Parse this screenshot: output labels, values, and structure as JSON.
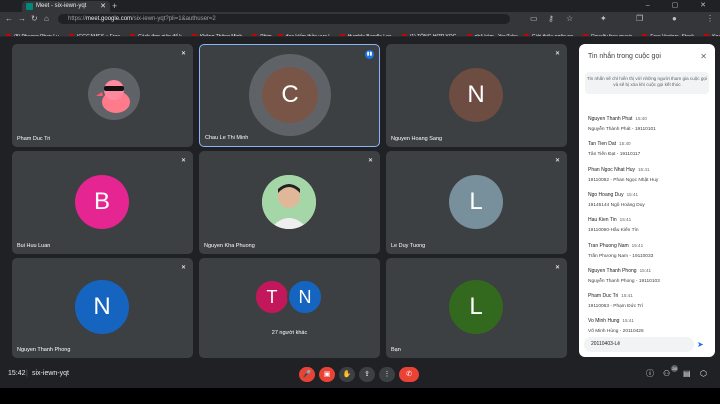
{
  "browser": {
    "tab_title": "Meet - six-iewn-yqt",
    "url_host": "meet.google.com",
    "url_path": "/six-iewn-yqt?pli=1&authuser=2",
    "url_prefix": "https://",
    "bookmarks": [
      "(8) Phuong Phap Lu...",
      "IGGGAMES » Free...",
      "Cách đơn giản để k...",
      "Không Thông Minh...",
      "Phim",
      "đao kiếm thần vực |...",
      "Humble Bundle | ga...",
      "(1) TỔNG HỢP YOG...",
      "phả kèm - YouTube",
      "Giới thiệu ngôn ng...",
      "Royalty free music...",
      "Free Vectors, Stock...",
      "Kpaix | Trang chủ"
    ]
  },
  "participants": [
    {
      "name": "Pham Duc Tri",
      "initial": "",
      "color": "#5f6368"
    },
    {
      "name": "Chau Le Thi Minh",
      "initial": "C",
      "color": "#795548"
    },
    {
      "name": "Nguyen Hoang Sang",
      "initial": "N",
      "color": "#6d4c41"
    },
    {
      "name": "Bui Huu Luan",
      "initial": "B",
      "color": "#e52592"
    },
    {
      "name": "Nguyen Kha Phuong",
      "initial": "",
      "color": "#9e9e9e"
    },
    {
      "name": "Le Duy Tuong",
      "initial": "L",
      "color": "#78909c"
    },
    {
      "name": "Nguyen Thanh Phong",
      "initial": "N",
      "color": "#1565c0"
    },
    {
      "name": "27 người khác",
      "initial": "",
      "color": "#3c4043",
      "others": [
        "T",
        "N"
      ]
    },
    {
      "name": "Bạn",
      "initial": "L",
      "color": "#33691e"
    }
  ],
  "chat": {
    "title": "Tin nhắn trong cuộc gọi",
    "info": "Tin nhắn sẽ chỉ hiển thị với những người tham gia cuộc gọi và sẽ bị xóa khi cuộc gọi kết thúc",
    "messages": [
      {
        "who": "Nguyen Thanh Phat",
        "time": "15:40",
        "text": "Nguyễn Thành Phát - 19110101"
      },
      {
        "who": "Tan Tien Dat",
        "time": "15:40",
        "text": "Tân Tiến Đạt - 19110117"
      },
      {
        "who": "Phan Ngoc Nhat Huy",
        "time": "15:41",
        "text": "19110082 - Phan Ngọc Nhật Huy"
      },
      {
        "who": "Ngo Hoang Duy",
        "time": "15:41",
        "text": "19145144 Ngô Hoàng Duy"
      },
      {
        "who": "Hau Kien Tin",
        "time": "15:41",
        "text": "19110060-Hầu Kiến Tín"
      },
      {
        "who": "Tran Phuong Nam",
        "time": "15:41",
        "text": "Trần Phương Nam - 19110033"
      },
      {
        "who": "Nguyen Thanh Phong",
        "time": "15:41",
        "text": "Nguyễn Thanh Phong - 19110103"
      },
      {
        "who": "Pham Duc Tri",
        "time": "15:41",
        "text": "19110063 - Phạm Đức Trí"
      },
      {
        "who": "Vo Minh Hung",
        "time": "15:41",
        "text": "Võ Minh Hùng - 20110426"
      }
    ],
    "input_value": "20110403-Lê",
    "send_icon": "send-icon"
  },
  "meeting": {
    "time": "15:42",
    "code": "six-iewn-yqt",
    "people_count": "28"
  }
}
